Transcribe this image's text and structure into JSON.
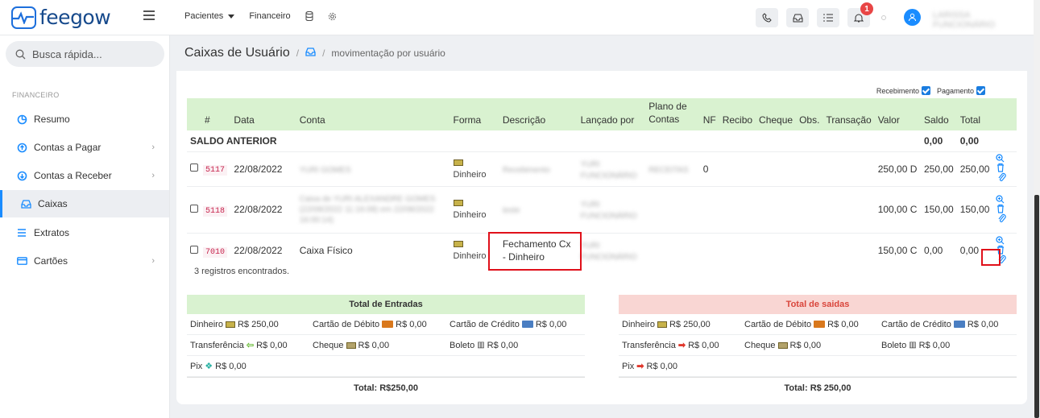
{
  "app": {
    "name": "feegow"
  },
  "topnav": {
    "pacientes": "Pacientes",
    "financeiro": "Financeiro",
    "notifications": "1",
    "user": "LARISSA FUNCIONÁRIO"
  },
  "search": {
    "placeholder": "Busca rápida..."
  },
  "sidebar": {
    "section": "FINANCEIRO",
    "items": [
      {
        "label": "Resumo",
        "icon": "pie-chart-icon"
      },
      {
        "label": "Contas a Pagar",
        "icon": "arrow-up-circle-icon"
      },
      {
        "label": "Contas a Receber",
        "icon": "arrow-down-circle-icon"
      },
      {
        "label": "Caixas",
        "icon": "inbox-icon"
      },
      {
        "label": "Extratos",
        "icon": "list-icon"
      },
      {
        "label": "Cartões",
        "icon": "credit-card-icon"
      }
    ]
  },
  "header": {
    "title": "Caixas de Usuário",
    "crumb": "movimentação por usuário"
  },
  "filters": {
    "recebimento": "Recebimento",
    "pagamento": "Pagamento"
  },
  "table": {
    "columns": [
      "#",
      "Data",
      "Conta",
      "Forma",
      "Descrição",
      "Lançado por",
      "Plano de Contas",
      "NF",
      "Recibo",
      "Cheque",
      "Obs.",
      "Transação",
      "Valor",
      "Saldo",
      "Total"
    ],
    "saldo": {
      "label": "SALDO ANTERIOR",
      "saldo": "0,00",
      "total": "0,00"
    },
    "rows": [
      {
        "id": "5117",
        "date": "22/08/2022",
        "conta": "YURI GOMES",
        "forma": "Dinheiro",
        "descricao": "Recebimento",
        "lancado": "YURI FUNCIONÁRIO",
        "plano": "RECEITAS",
        "nf": "0",
        "valor": "250,00 D",
        "saldo": "250,00",
        "total": "250,00"
      },
      {
        "id": "5118",
        "date": "22/08/2022",
        "conta": "Caixa de YURI ALEXANDRE GOMES (22/08/2022 11:16:08) em 22/08/2022 16:00:14)",
        "forma": "Dinheiro",
        "descricao": "teste",
        "lancado": "YURI FUNCIONÁRIO",
        "plano": "",
        "nf": "",
        "valor": "100,00 C",
        "saldo": "150,00",
        "total": "150,00"
      },
      {
        "id": "7010",
        "date": "22/08/2022",
        "conta": "Caixa Físico",
        "forma": "Dinheiro",
        "descricao": "Fechamento Cx - Dinheiro",
        "lancado": "YURI FUNCIONÁRIO",
        "plano": "",
        "nf": "",
        "valor": "150,00 C",
        "saldo": "0,00",
        "total": "0,00"
      }
    ],
    "found": "3 registros encontrados."
  },
  "entradas": {
    "title": "Total de Entradas",
    "dinheiro": "Dinheiro",
    "dinheiro_v": "R$ 250,00",
    "debito": "Cartão de Débito",
    "debito_v": "R$ 0,00",
    "credito": "Cartão de Crédito",
    "credito_v": "R$ 0,00",
    "transf": "Transferência",
    "transf_v": "R$ 0,00",
    "cheque": "Cheque",
    "cheque_v": "R$ 0,00",
    "boleto": "Boleto",
    "boleto_v": "R$ 0,00",
    "pix": "Pix",
    "pix_v": "R$ 0,00",
    "total": "Total: R$250,00"
  },
  "saidas": {
    "title": "Total de saidas",
    "dinheiro": "Dinheiro",
    "dinheiro_v": "R$ 250,00",
    "debito": "Cartão de Débito",
    "debito_v": "R$ 0,00",
    "credito": "Cartão de Crédito",
    "credito_v": "R$ 0,00",
    "transf": "Transferência",
    "transf_v": "R$ 0,00",
    "cheque": "Cheque",
    "cheque_v": "R$ 0,00",
    "boleto": "Boleto",
    "boleto_v": "R$ 0,00",
    "pix": "Pix",
    "pix_v": "R$ 0,00",
    "total": "Total: R$ 250,00"
  },
  "colors": {
    "accent": "#1a8cff",
    "entradas": "#d9f2d0",
    "saidas": "#f9d6d3",
    "highlight": "#e0101a"
  }
}
